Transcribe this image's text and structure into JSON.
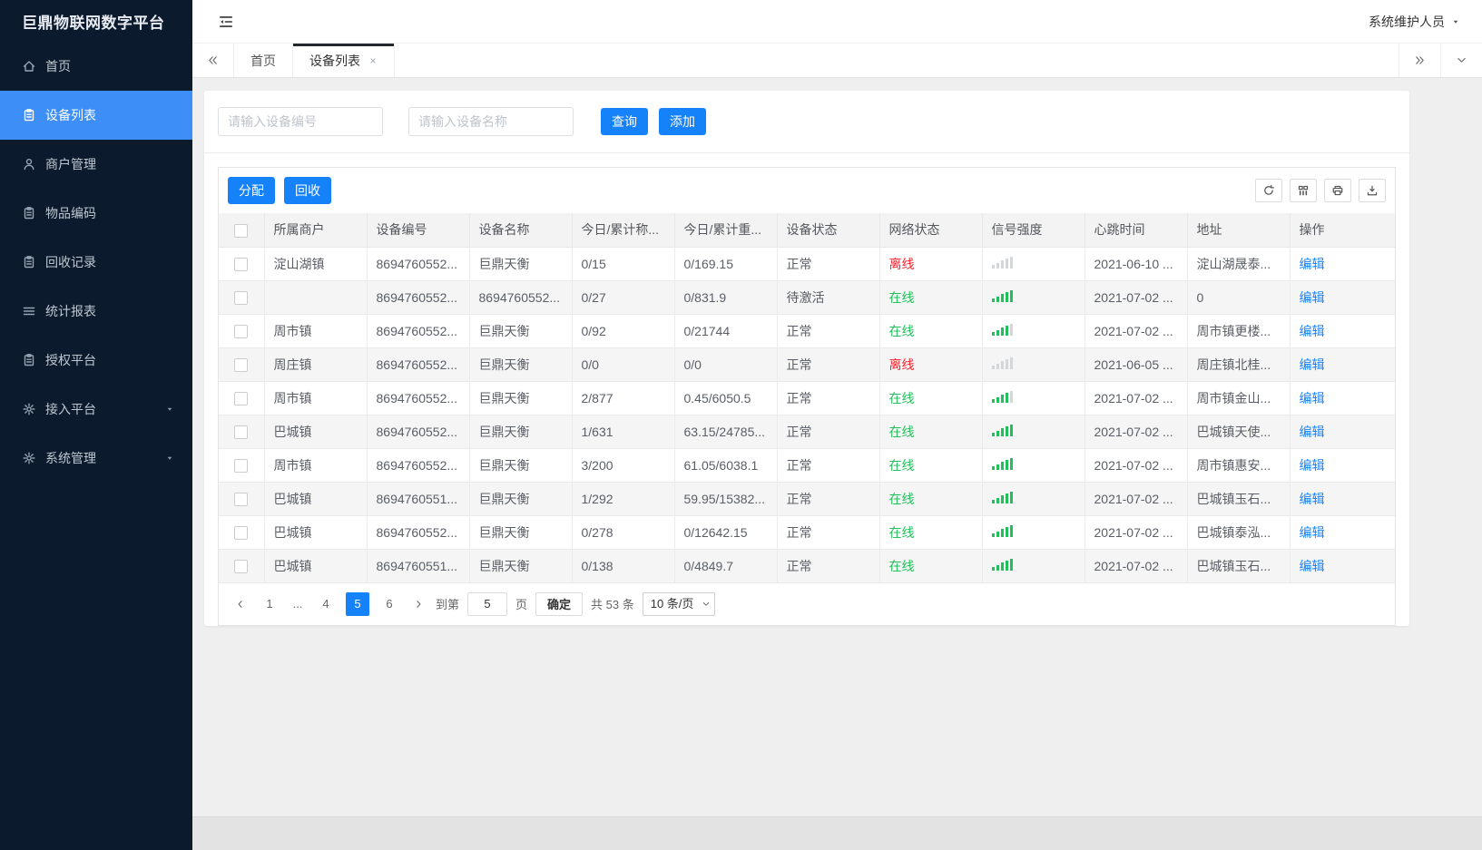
{
  "app": {
    "title": "巨鼎物联网数字平台",
    "user": "系统维护人员"
  },
  "colors": {
    "accent": "#1682fa",
    "sidebar_active": "#3e8ef7",
    "online_green": "#21c05b",
    "offline_red": "#f5222d",
    "link_blue": "#1682fa"
  },
  "sidebar": {
    "items": [
      {
        "slug": "home",
        "label": "首页",
        "icon": "home-icon",
        "active": false,
        "expandable": false
      },
      {
        "slug": "device-list",
        "label": "设备列表",
        "icon": "doc-icon",
        "active": true,
        "expandable": false
      },
      {
        "slug": "merchant-management",
        "label": "商户管理",
        "icon": "user-icon",
        "active": false,
        "expandable": false
      },
      {
        "slug": "item-code",
        "label": "物品编码",
        "icon": "doc-icon",
        "active": false,
        "expandable": false
      },
      {
        "slug": "recycle-records",
        "label": "回收记录",
        "icon": "doc-icon",
        "active": false,
        "expandable": false
      },
      {
        "slug": "statistics-report",
        "label": "统计报表",
        "icon": "list-icon",
        "active": false,
        "expandable": false
      },
      {
        "slug": "authorization-platform",
        "label": "授权平台",
        "icon": "doc-icon",
        "active": false,
        "expandable": false
      },
      {
        "slug": "access-platform",
        "label": "接入平台",
        "icon": "gear-icon",
        "active": false,
        "expandable": true
      },
      {
        "slug": "system-management",
        "label": "系统管理",
        "icon": "gear-icon",
        "active": false,
        "expandable": true
      }
    ]
  },
  "tabs": {
    "items": [
      {
        "slug": "home",
        "label": "首页",
        "active": false,
        "closable": false
      },
      {
        "slug": "device-list",
        "label": "设备列表",
        "active": true,
        "closable": true
      }
    ]
  },
  "search": {
    "device_no_placeholder": "请输入设备编号",
    "device_name_placeholder": "请输入设备名称",
    "query_label": "查询",
    "add_label": "添加"
  },
  "toolbar": {
    "assign_label": "分配",
    "recycle_label": "回收",
    "icons": [
      "refresh-icon",
      "columns-icon",
      "print-icon",
      "download-icon"
    ]
  },
  "table": {
    "columns": [
      "所属商户",
      "设备编号",
      "设备名称",
      "今日/累计称...",
      "今日/累计重...",
      "设备状态",
      "网络状态",
      "信号强度",
      "心跳时间",
      "地址",
      "操作"
    ],
    "edit_label": "编辑",
    "rows": [
      {
        "merchant": "淀山湖镇",
        "device_no": "8694760552...",
        "device_name": "巨鼎天衡",
        "today_count": "0/15",
        "today_weight": "0/169.15",
        "status": "正常",
        "network": "离线",
        "online": false,
        "signal": 0,
        "heartbeat": "2021-06-10 ...",
        "address": "淀山湖晟泰..."
      },
      {
        "merchant": "",
        "device_no": "8694760552...",
        "device_name": "8694760552...",
        "today_count": "0/27",
        "today_weight": "0/831.9",
        "status": "待激活",
        "network": "在线",
        "online": true,
        "signal": 5,
        "heartbeat": "2021-07-02 ...",
        "address": "0"
      },
      {
        "merchant": "周市镇",
        "device_no": "8694760552...",
        "device_name": "巨鼎天衡",
        "today_count": "0/92",
        "today_weight": "0/21744",
        "status": "正常",
        "network": "在线",
        "online": true,
        "signal": 4,
        "heartbeat": "2021-07-02 ...",
        "address": "周市镇更楼..."
      },
      {
        "merchant": "周庄镇",
        "device_no": "8694760552...",
        "device_name": "巨鼎天衡",
        "today_count": "0/0",
        "today_weight": "0/0",
        "status": "正常",
        "network": "离线",
        "online": false,
        "signal": 0,
        "heartbeat": "2021-06-05 ...",
        "address": "周庄镇北桂..."
      },
      {
        "merchant": "周市镇",
        "device_no": "8694760552...",
        "device_name": "巨鼎天衡",
        "today_count": "2/877",
        "today_weight": "0.45/6050.5",
        "status": "正常",
        "network": "在线",
        "online": true,
        "signal": 4,
        "heartbeat": "2021-07-02 ...",
        "address": "周市镇金山..."
      },
      {
        "merchant": "巴城镇",
        "device_no": "8694760552...",
        "device_name": "巨鼎天衡",
        "today_count": "1/631",
        "today_weight": "63.15/24785...",
        "status": "正常",
        "network": "在线",
        "online": true,
        "signal": 5,
        "heartbeat": "2021-07-02 ...",
        "address": "巴城镇天使..."
      },
      {
        "merchant": "周市镇",
        "device_no": "8694760552...",
        "device_name": "巨鼎天衡",
        "today_count": "3/200",
        "today_weight": "61.05/6038.1",
        "status": "正常",
        "network": "在线",
        "online": true,
        "signal": 5,
        "heartbeat": "2021-07-02 ...",
        "address": "周市镇惠安..."
      },
      {
        "merchant": "巴城镇",
        "device_no": "8694760551...",
        "device_name": "巨鼎天衡",
        "today_count": "1/292",
        "today_weight": "59.95/15382...",
        "status": "正常",
        "network": "在线",
        "online": true,
        "signal": 5,
        "heartbeat": "2021-07-02 ...",
        "address": "巴城镇玉石..."
      },
      {
        "merchant": "巴城镇",
        "device_no": "8694760552...",
        "device_name": "巨鼎天衡",
        "today_count": "0/278",
        "today_weight": "0/12642.15",
        "status": "正常",
        "network": "在线",
        "online": true,
        "signal": 5,
        "heartbeat": "2021-07-02 ...",
        "address": "巴城镇泰泓..."
      },
      {
        "merchant": "巴城镇",
        "device_no": "8694760551...",
        "device_name": "巨鼎天衡",
        "today_count": "0/138",
        "today_weight": "0/4849.7",
        "status": "正常",
        "network": "在线",
        "online": true,
        "signal": 5,
        "heartbeat": "2021-07-02 ...",
        "address": "巴城镇玉石..."
      }
    ]
  },
  "pagination": {
    "pages": [
      "1",
      "...",
      "4",
      "5",
      "6"
    ],
    "active_page": "5",
    "goto_label": "到第",
    "goto_value": "5",
    "page_unit_label": "页",
    "confirm_label": "确定",
    "total_label": "共 53 条",
    "page_size_option": "10 条/页"
  }
}
